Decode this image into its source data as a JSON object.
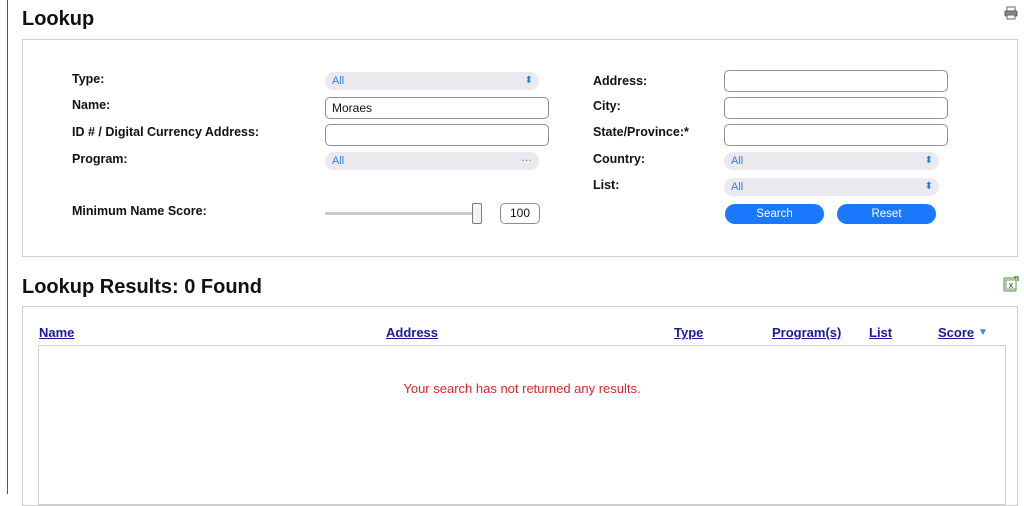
{
  "lookup": {
    "title": "Lookup",
    "labels": {
      "type": "Type:",
      "name": "Name:",
      "id": "ID # / Digital Currency Address:",
      "program": "Program:",
      "min_score": "Minimum Name Score:",
      "address": "Address:",
      "city": "City:",
      "state": "State/Province:*",
      "country": "Country:",
      "list": "List:"
    },
    "type_value": "All",
    "name_value": "Moraes",
    "id_value": "",
    "program_value": "All",
    "address_value": "",
    "city_value": "",
    "state_value": "",
    "country_value": "All",
    "list_value": "All",
    "min_score_value": "100",
    "min_score_fraction": 1.0,
    "search_label": "Search",
    "reset_label": "Reset"
  },
  "results": {
    "title": "Lookup Results: 0 Found",
    "columns": [
      "Name",
      "Address",
      "Type",
      "Program(s)",
      "List",
      "Score"
    ],
    "empty_message": "Your search has not returned any results."
  },
  "icons": {
    "print": "print-icon",
    "export": "excel-export-icon",
    "sort": "sort-desc-icon",
    "select_chevron": "updown-chevron-icon"
  },
  "colors": {
    "accent": "#1a78ff",
    "link": "#1a1a9c",
    "error": "#d8282b",
    "select_text": "#2f7fe0"
  }
}
